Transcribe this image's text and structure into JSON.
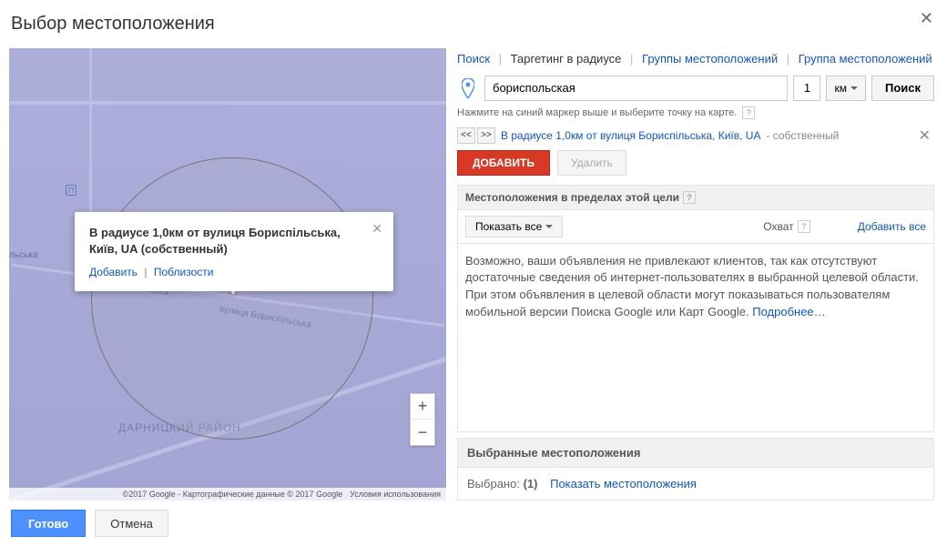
{
  "dialog": {
    "title": "Выбор местоположения"
  },
  "map": {
    "infowindow": {
      "title": "В радиусе 1,0км от вулиця Бориспільська, Київ, UA (собственный)",
      "add_link": "Добавить",
      "nearby_link": "Поблизости"
    },
    "street_label_1": "вулиця Бориспільська",
    "street_label_2": "льська",
    "area_label": "ДАРНИЦКИЙ РАЙОН",
    "attr_data": "©2017 Google - Картографические данные © 2017 Google",
    "attr_terms": "Условия использования"
  },
  "tabs": {
    "search": "Поиск",
    "radius": "Таргетинг в радиусе",
    "groups": "Группы местоположений",
    "group": "Группа местоположений"
  },
  "search": {
    "value": "бориспольская",
    "distance": "1",
    "unit": "км",
    "button": "Поиск"
  },
  "hint": "Нажмите на синий маркер выше и выберите точку на карте.",
  "result": {
    "text": "В радиусе 1,0км от вулиця Бориспільська, Київ, UA",
    "own": " - собственный"
  },
  "actions": {
    "add": "ДОБАВИТЬ",
    "del": "Удалить"
  },
  "inner": {
    "header": "Местоположения в пределах этой цели",
    "show_all": "Показать все",
    "reach": "Охват",
    "add_all": "Добавить все"
  },
  "warning": {
    "text": "Возможно, ваши объявления не привлекают клиентов, так как отсутствуют достаточные сведения об интернет-пользователях в выбранной целевой области. При этом объявления в целевой области могут показываться пользователям мобильной версии Поиска Google или Карт Google. ",
    "more": "Подробнее…"
  },
  "selected": {
    "header": "Выбранные местоположения",
    "count_label": "Выбрано:",
    "count": "(1)",
    "show_link": "Показать местоположения"
  },
  "footer": {
    "done": "Готово",
    "cancel": "Отмена"
  }
}
